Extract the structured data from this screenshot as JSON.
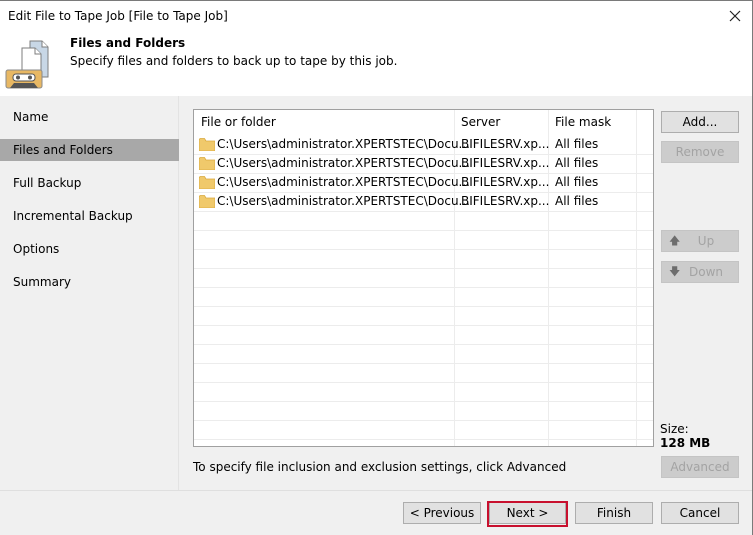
{
  "window": {
    "title": "Edit File to Tape Job [File to Tape Job]"
  },
  "header": {
    "title": "Files and Folders",
    "subtitle": "Specify files and folders to back up to tape by this job.",
    "icon": "files-to-tape-icon"
  },
  "sidebar": {
    "items": [
      {
        "label": "Name",
        "active": false
      },
      {
        "label": "Files and Folders",
        "active": true
      },
      {
        "label": "Full Backup",
        "active": false
      },
      {
        "label": "Incremental Backup",
        "active": false
      },
      {
        "label": "Options",
        "active": false
      },
      {
        "label": "Summary",
        "active": false
      }
    ]
  },
  "table": {
    "columns": [
      "File or folder",
      "Server",
      "File mask"
    ],
    "rows": [
      {
        "path": "C:\\Users\\administrator.XPERTSTEC\\Docu...",
        "server": "BIFILESRV.xp...",
        "mask": "All files",
        "icon": "folder-icon"
      },
      {
        "path": "C:\\Users\\administrator.XPERTSTEC\\Docu...",
        "server": "BIFILESRV.xp...",
        "mask": "All files",
        "icon": "folder-icon"
      },
      {
        "path": "C:\\Users\\administrator.XPERTSTEC\\Docu...",
        "server": "BIFILESRV.xp...",
        "mask": "All files",
        "icon": "folder-icon"
      },
      {
        "path": "C:\\Users\\administrator.XPERTSTEC\\Docu...",
        "server": "BIFILESRV.xp...",
        "mask": "All files",
        "icon": "folder-icon"
      }
    ]
  },
  "side_buttons": {
    "add": "Add...",
    "remove": "Remove",
    "up": "Up",
    "down": "Down",
    "advanced": "Advanced"
  },
  "size": {
    "label": "Size:",
    "value": "128 MB"
  },
  "hint": "To specify file inclusion and exclusion settings, click Advanced",
  "footer": {
    "previous": "< Previous",
    "next": "Next >",
    "finish": "Finish",
    "cancel": "Cancel"
  },
  "colors": {
    "active_nav": "#a8a8a8",
    "highlight": "#c8102e",
    "folder": "#f0c96b"
  }
}
